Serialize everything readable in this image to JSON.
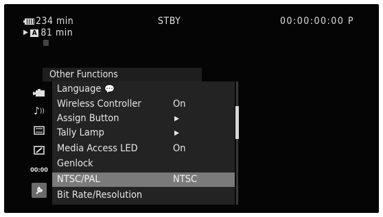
{
  "status": {
    "battery_time": "234 min",
    "battery_icon": "battery-icon",
    "media_slot": "A",
    "media_time": "81 min",
    "mode": "STBY",
    "timecode": "00:00:00:00 P"
  },
  "menu": {
    "title": "Other Functions",
    "items": [
      {
        "label": "Language",
        "value": "",
        "icon": "speech-bubble-icon"
      },
      {
        "label": "Wireless Controller",
        "value": "On"
      },
      {
        "label": "Assign Button",
        "value": "▶"
      },
      {
        "label": "Tally Lamp",
        "value": "▶"
      },
      {
        "label": "Media Access LED",
        "value": "On"
      },
      {
        "label": "Genlock",
        "value": ""
      },
      {
        "label": "NTSC/PAL",
        "value": "NTSC",
        "selected": true
      },
      {
        "label": "Bit Rate/Resolution",
        "value": ""
      }
    ],
    "sidebar_icons": [
      "camera-icon",
      "audio-icon",
      "video-setup-icon",
      "lcd-setup-icon",
      "timecode-icon",
      "system-setup-icon"
    ],
    "timecode_icon_label": "00:00",
    "selected_value_color": "#7a7a7a",
    "background_color": "#050505"
  }
}
